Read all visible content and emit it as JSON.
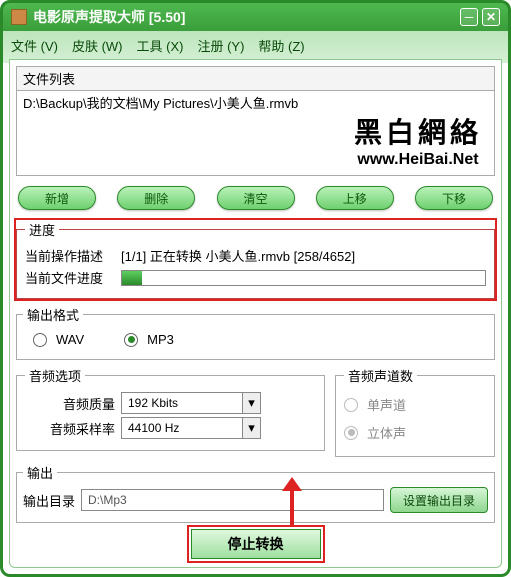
{
  "window": {
    "title": "电影原声提取大师  [5.50]"
  },
  "menu": {
    "file": "文件 (V)",
    "skin": "皮肤 (W)",
    "tools": "工具 (X)",
    "register": "注册 (Y)",
    "help": "帮助 (Z)"
  },
  "filelist": {
    "header": "文件列表",
    "items": [
      "D:\\Backup\\我的文档\\My Pictures\\小美人鱼.rmvb"
    ]
  },
  "watermark": {
    "line1": "黑白網絡",
    "line2": "www.HeiBai.Net"
  },
  "listbtn": {
    "add": "新增",
    "del": "删除",
    "clear": "清空",
    "up": "上移",
    "down": "下移"
  },
  "progress": {
    "group": "进度",
    "desc_label": "当前操作描述",
    "desc_value": "[1/1] 正在转换 小美人鱼.rmvb  [258/4652]",
    "file_label": "当前文件进度",
    "percent": 5.5
  },
  "outfmt": {
    "group": "输出格式",
    "wav": "WAV",
    "mp3": "MP3",
    "selected": "mp3"
  },
  "audio": {
    "group": "音频选项",
    "quality_label": "音频质量",
    "quality_value": "192 Kbits",
    "rate_label": "音频采样率",
    "rate_value": "44100 Hz"
  },
  "channels": {
    "group": "音频声道数",
    "mono": "单声道",
    "stereo": "立体声",
    "selected": "stereo"
  },
  "output": {
    "group": "输出",
    "dir_label": "输出目录",
    "dir_value": "D:\\Mp3",
    "set_btn": "设置输出目录"
  },
  "stop_btn": "停止转换"
}
